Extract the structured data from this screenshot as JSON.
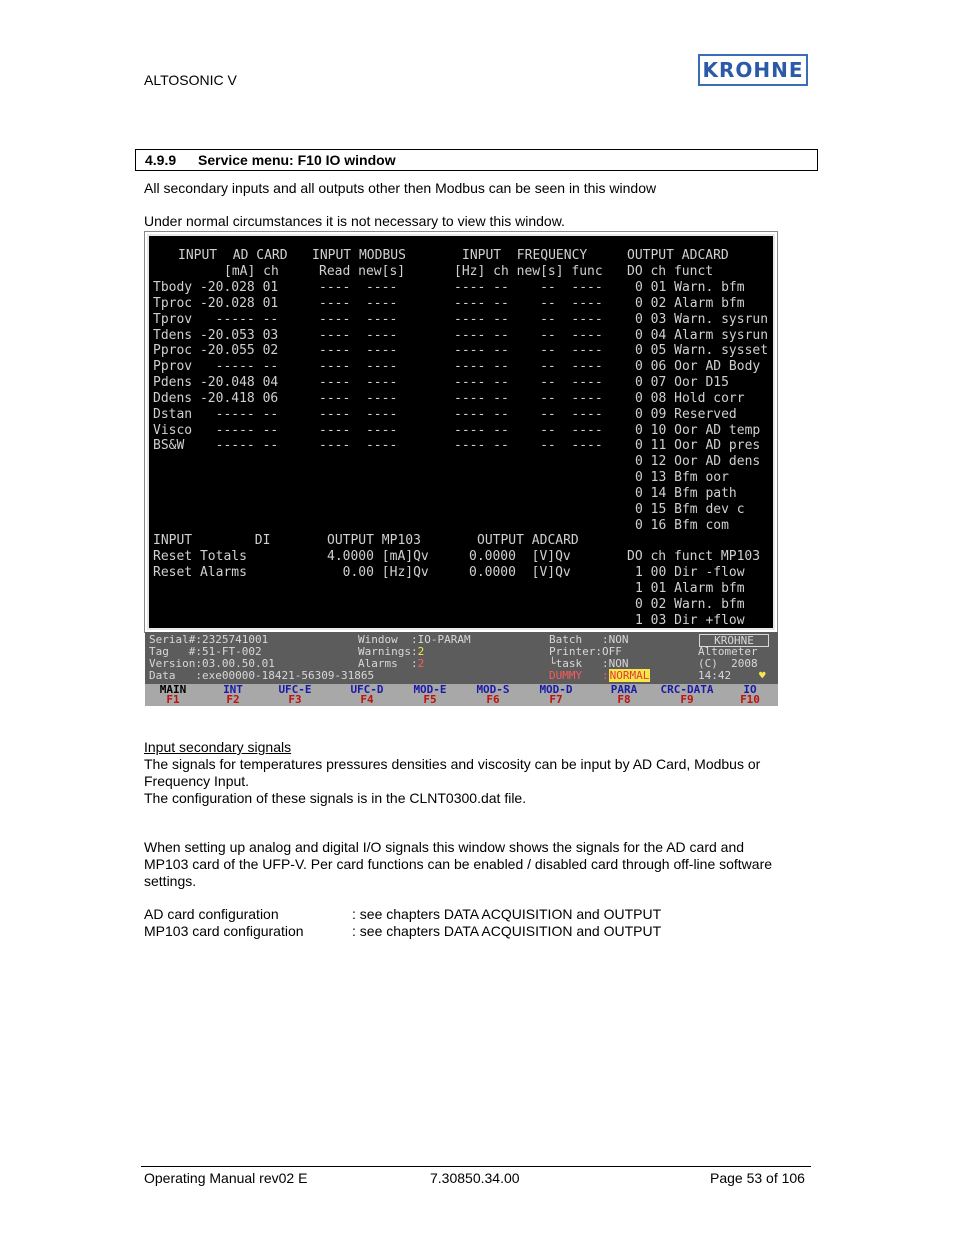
{
  "header": {
    "doc_title": "ALTOSONIC V",
    "logo_text": "KROHNE"
  },
  "section": {
    "number": "4.9.9",
    "title": "Service menu: F10 IO window"
  },
  "intro": [
    "All secondary inputs and all outputs other then Modbus can be seen in this window",
    "Under normal circumstances it is not necessary to view this window."
  ],
  "screen": {
    "input_ad_card": {
      "title": "INPUT  AD CARD",
      "units_header": "[mA] ch",
      "rows": [
        {
          "name": "Tbody",
          "value": "-20.028",
          "ch": "01"
        },
        {
          "name": "Tproc",
          "value": "-20.028",
          "ch": "01"
        },
        {
          "name": "Tprov",
          "value": "-----",
          "ch": "--"
        },
        {
          "name": "Tdens",
          "value": "-20.053",
          "ch": "03"
        },
        {
          "name": "Pproc",
          "value": "-20.055",
          "ch": "02"
        },
        {
          "name": "Pprov",
          "value": "-----",
          "ch": "--"
        },
        {
          "name": "Pdens",
          "value": "-20.048",
          "ch": "04"
        },
        {
          "name": "Ddens",
          "value": "-20.418",
          "ch": "06"
        },
        {
          "name": "Dstan",
          "value": "-----",
          "ch": "--"
        },
        {
          "name": "Visco",
          "value": "-----",
          "ch": "--"
        },
        {
          "name": "BS&W",
          "value": "-----",
          "ch": "--"
        }
      ]
    },
    "input_modbus": {
      "title": "INPUT MODBUS",
      "header": "Read new[s]",
      "row_value": "----  ----",
      "row_count": 11
    },
    "input_frequency": {
      "title": "INPUT  FREQUENCY",
      "header": "[Hz] ch new[s] func",
      "row_value": "---- --    --  ----",
      "row_count": 11
    },
    "output_adcard": {
      "title": "OUTPUT ADCARD",
      "header": "DO ch funct",
      "rows": [
        {
          "do": "0",
          "ch": "01",
          "funct": "Warn. bfm"
        },
        {
          "do": "0",
          "ch": "02",
          "funct": "Alarm bfm"
        },
        {
          "do": "0",
          "ch": "03",
          "funct": "Warn. sysrun"
        },
        {
          "do": "0",
          "ch": "04",
          "funct": "Alarm sysrun"
        },
        {
          "do": "0",
          "ch": "05",
          "funct": "Warn. sysset"
        },
        {
          "do": "0",
          "ch": "06",
          "funct": "Oor AD Body"
        },
        {
          "do": "0",
          "ch": "07",
          "funct": "Oor D15"
        },
        {
          "do": "0",
          "ch": "08",
          "funct": "Hold corr"
        },
        {
          "do": "0",
          "ch": "09",
          "funct": "Reserved"
        },
        {
          "do": "0",
          "ch": "10",
          "funct": "Oor AD temp"
        },
        {
          "do": "0",
          "ch": "11",
          "funct": "Oor AD pres"
        },
        {
          "do": "0",
          "ch": "12",
          "funct": "Oor AD dens"
        },
        {
          "do": "0",
          "ch": "13",
          "funct": "Bfm oor"
        },
        {
          "do": "0",
          "ch": "14",
          "funct": "Bfm path"
        },
        {
          "do": "0",
          "ch": "15",
          "funct": "Bfm dev c"
        },
        {
          "do": "0",
          "ch": "16",
          "funct": "Bfm com"
        }
      ]
    },
    "input_di": {
      "title": "INPUT        DI",
      "rows": [
        "Reset Totals",
        "Reset Alarms"
      ]
    },
    "output_mp103": {
      "title": "OUTPUT MP103",
      "rows": [
        "4.0000 [mA]Qv",
        "  0.00 [Hz]Qv"
      ]
    },
    "output_adcard_analog": {
      "title": "OUTPUT ADCARD",
      "rows": [
        "0.0000  [V]Qv",
        "0.0000  [V]Qv"
      ]
    },
    "do_mp103": {
      "header": "DO ch funct MP103",
      "rows": [
        {
          "do": "1",
          "ch": "00",
          "funct": "Dir -flow"
        },
        {
          "do": "1",
          "ch": "01",
          "funct": "Alarm bfm"
        },
        {
          "do": "0",
          "ch": "02",
          "funct": "Warn. bfm"
        },
        {
          "do": "1",
          "ch": "03",
          "funct": "Dir +flow"
        }
      ]
    }
  },
  "status_bar": {
    "serial_label": "Serial#:",
    "serial": "2325741001",
    "tag_label": "Tag   #:",
    "tag": "51-FT-002",
    "version_label": "Version:",
    "version": "03.00.50.01",
    "data_label": "Data   :",
    "data": "exe00000-18421-56309-31865",
    "window_label": "Window  :",
    "window": "IO-PARAM",
    "warnings_label": "Warnings:",
    "warnings": "2",
    "alarms_label": "Alarms  :",
    "alarms": "2",
    "batch_label": "Batch   :",
    "batch": "NON",
    "printer_label": "Printer:",
    "printer": "OFF",
    "task_label": "└task   :",
    "task": "NON",
    "dummy_label": "DUMMY   :",
    "dummy": "NORMAL",
    "brand": "KROHNE",
    "product": "Altometer",
    "copyright": "(C)  2008",
    "time": "14:42",
    "heart": "♥"
  },
  "function_keys": [
    {
      "label": "MAIN",
      "key": "F1",
      "active": true
    },
    {
      "label": "INT",
      "key": "F2"
    },
    {
      "label": "UFC-E",
      "key": "F3"
    },
    {
      "label": "UFC-D",
      "key": "F4"
    },
    {
      "label": "MOD-E",
      "key": "F5"
    },
    {
      "label": "MOD-S",
      "key": "F6"
    },
    {
      "label": "MOD-D",
      "key": "F7"
    },
    {
      "label": "PARA",
      "key": "F8"
    },
    {
      "label": "CRC-DATA",
      "key": "F9"
    },
    {
      "label": "IO",
      "key": "F10"
    }
  ],
  "body": {
    "subheading": "Input secondary signals",
    "p1_line1": "The signals for temperatures pressures densities and viscosity can be input by AD Card, Modbus or",
    "p1_line2": "Frequency Input.",
    "p1_line3": "The configuration of these signals is in the CLNT0300.dat file.",
    "p2_line1": "When setting up analog and digital I/O signals this window shows the signals for the AD card and",
    "p2_line2": "MP103 card of the UFP-V. Per card functions can be enabled / disabled card through off-line software",
    "p2_line3": "settings.",
    "config": [
      {
        "label": "AD card configuration",
        "value": ": see chapters DATA ACQUISITION and OUTPUT"
      },
      {
        "label": "MP103  card configuration",
        "value": ": see chapters DATA ACQUISITION and OUTPUT"
      }
    ]
  },
  "footer": {
    "left": "Operating Manual  rev02 E",
    "center": "7.30850.34.00",
    "right": "Page 53 of 106"
  }
}
